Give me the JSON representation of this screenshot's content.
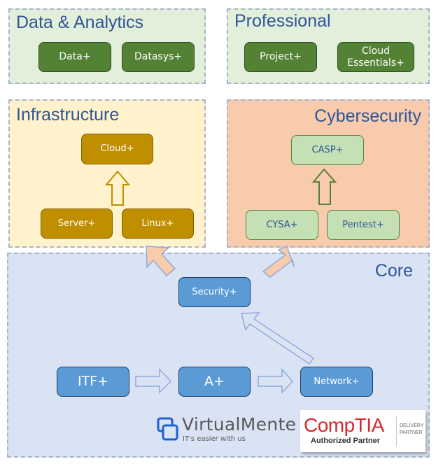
{
  "panels": {
    "data_analytics": {
      "title": "Data & Analytics",
      "nodes": [
        "Data+",
        "Datasys+"
      ]
    },
    "professional": {
      "title": "Professional",
      "nodes": [
        "Project+",
        "Cloud Essentials+"
      ]
    },
    "infrastructure": {
      "title": "Infrastructure",
      "nodes": [
        "Cloud+",
        "Server+",
        "Linux+"
      ]
    },
    "cybersecurity": {
      "title": "Cybersecurity",
      "nodes": [
        "CASP+",
        "CYSA+",
        "Pentest+"
      ]
    },
    "core": {
      "title": "Core",
      "nodes": [
        "Security+",
        "ITF+",
        "A+",
        "Network+"
      ]
    }
  },
  "colors": {
    "green_panel": "#e2efda",
    "infra_panel": "#fff2cc",
    "cyber_panel": "#f8cbad",
    "core_panel": "#dae3f3",
    "title_blue": "#2f5597",
    "dark_green_node": "#548235",
    "gold_node": "#bf8f00",
    "light_green_node": "#c5e0b4",
    "blue_node": "#5b9bd5"
  },
  "logos": {
    "virtualmente": {
      "name": "VirtualMente",
      "tagline": "IT's easier with us"
    },
    "comptia": {
      "name": "CompTIA",
      "subtitle": "Authorized Partner",
      "badge_line1": "DELIVERY",
      "badge_line2": "PARTNER"
    }
  }
}
